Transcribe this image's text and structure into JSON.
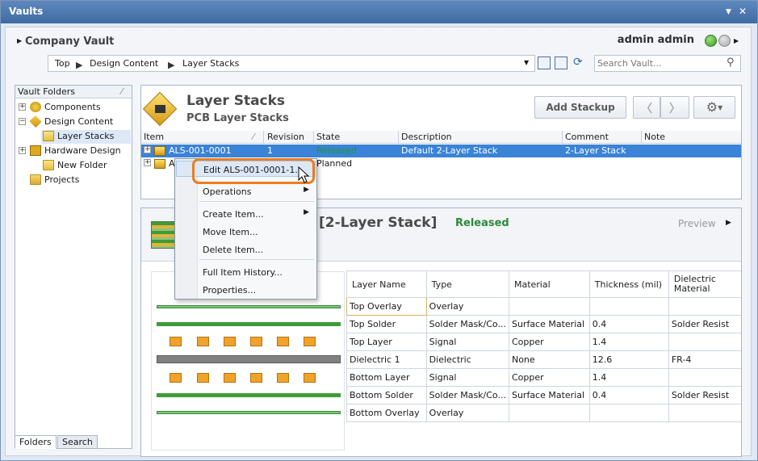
{
  "window": {
    "title": "Vaults"
  },
  "header": {
    "vault_name": "Company Vault",
    "user": "admin admin"
  },
  "breadcrumb": [
    "Top",
    "Design Content",
    "Layer Stacks"
  ],
  "search": {
    "placeholder": "Search Vault..."
  },
  "left_panel": {
    "header": "Vault Folders",
    "tree": [
      {
        "label": "Components",
        "level": 0,
        "expander": "+"
      },
      {
        "label": "Design Content",
        "level": 0,
        "expander": "−"
      },
      {
        "label": "Layer Stacks",
        "level": 1,
        "selected": true
      },
      {
        "label": "Hardware Design",
        "level": 0,
        "expander": "+"
      },
      {
        "label": "New Folder",
        "level": 1
      },
      {
        "label": "Projects",
        "level": 0
      }
    ],
    "tabs": [
      "Folders",
      "Search"
    ]
  },
  "folder_panel": {
    "title": "Layer Stacks",
    "subtitle": "PCB Layer Stacks",
    "add_button": "Add Stackup"
  },
  "grid": {
    "columns": [
      "Item",
      "Revision",
      "State",
      "Description",
      "Comment",
      "Note"
    ],
    "rows": [
      {
        "item": "ALS-001-0001",
        "revision": "1",
        "state": "Released",
        "description": "Default 2-Layer Stack",
        "comment": "2-Layer Stack",
        "note": ""
      },
      {
        "item": "A",
        "revision": "",
        "state": "Planned",
        "description": "",
        "comment": "",
        "note": ""
      }
    ]
  },
  "context_menu": {
    "items": [
      {
        "label": "Edit ALS-001-0001-1..."
      },
      {
        "label": "Operations",
        "submenu": true
      },
      {
        "label": "Create Item...",
        "submenu": true
      },
      {
        "label": "Move Item..."
      },
      {
        "label": "Delete Item..."
      },
      {
        "label": "Full Item History..."
      },
      {
        "label": "Properties..."
      }
    ]
  },
  "detail": {
    "title": "[2-Layer Stack]",
    "status": "Released",
    "preview_label": "Preview",
    "status_color": "#2a8a3a"
  },
  "layers": {
    "columns": [
      "Layer Name",
      "Type",
      "Material",
      "Thickness (mil)",
      "Dielectric Material"
    ],
    "rows": [
      [
        "Top Overlay",
        "Overlay",
        "",
        "",
        ""
      ],
      [
        "Top Solder",
        "Solder Mask/Co...",
        "Surface Material",
        "0.4",
        "Solder Resist"
      ],
      [
        "Top Layer",
        "Signal",
        "Copper",
        "1.4",
        ""
      ],
      [
        "Dielectric 1",
        "Dielectric",
        "None",
        "12.6",
        "FR-4"
      ],
      [
        "Bottom Layer",
        "Signal",
        "Copper",
        "1.4",
        ""
      ],
      [
        "Bottom Solder",
        "Solder Mask/Co...",
        "Surface Material",
        "0.4",
        "Solder Resist"
      ],
      [
        "Bottom Overlay",
        "Overlay",
        "",
        "",
        ""
      ]
    ]
  },
  "colors": {
    "accent": "#3b83d6",
    "highlight_ring": "#ec7d1e",
    "released": "#2a8a3a"
  }
}
